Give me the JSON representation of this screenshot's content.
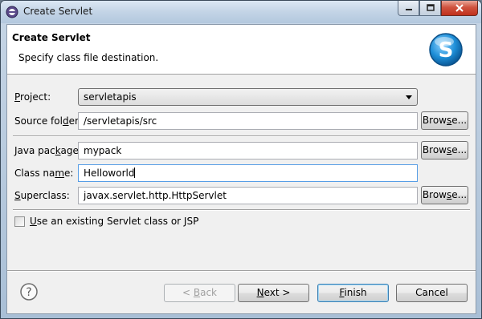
{
  "window": {
    "title": "Create Servlet"
  },
  "header": {
    "title": "Create Servlet",
    "description": "Specify class file destination.",
    "logo_letter": "S"
  },
  "form": {
    "project": {
      "label_ul": "P",
      "label_rest": "roject:",
      "value": "servletapis"
    },
    "source_folder": {
      "label_pre": "Source fol",
      "label_ul": "d",
      "label_rest": "er:",
      "value": "/servletapis/src"
    },
    "java_package": {
      "label_pre": "Java pac",
      "label_ul": "k",
      "label_rest": "age:",
      "value": "mypack"
    },
    "class_name": {
      "label_pre": "Class na",
      "label_ul": "m",
      "label_rest": "e:",
      "value": "Helloworld"
    },
    "superclass": {
      "label_ul": "S",
      "label_rest": "uperclass:",
      "value": "javax.servlet.http.HttpServlet"
    },
    "browse_pre": "Brow",
    "browse_ul": "s",
    "browse_rest": "e...",
    "existing_checkbox": {
      "label_ul": "U",
      "label_rest": "se an existing Servlet class or JSP",
      "checked": false
    }
  },
  "buttons": {
    "back": {
      "pre": "< ",
      "ul": "B",
      "rest": "ack"
    },
    "next": {
      "ul": "N",
      "rest": "ext >"
    },
    "finish": {
      "ul": "F",
      "rest": "inish"
    },
    "cancel": "Cancel"
  },
  "colors": {
    "focus_border": "#569de5",
    "close_button": "#c0301c",
    "logo_blue": "#1e8fd8"
  }
}
